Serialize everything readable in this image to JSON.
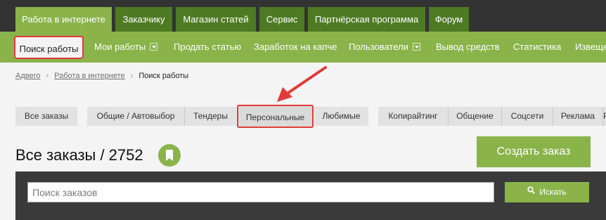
{
  "top_tabs": [
    {
      "label": "Работа в интернете"
    },
    {
      "label": "Заказчику"
    },
    {
      "label": "Магазин статей"
    },
    {
      "label": "Сервис"
    },
    {
      "label": "Партнёрская программа"
    },
    {
      "label": "Форум"
    }
  ],
  "subnav": [
    {
      "label": "Поиск работы"
    },
    {
      "label": "Мои работы"
    },
    {
      "label": "Продать статью"
    },
    {
      "label": "Заработок на капче"
    },
    {
      "label": "Пользователи"
    },
    {
      "label": "Вывод средств"
    },
    {
      "label": "Статистика"
    },
    {
      "label": "Извещен"
    }
  ],
  "breadcrumb": {
    "items": [
      "Адвего",
      "Работа в интернете"
    ],
    "current": "Поиск работы",
    "separator": "›"
  },
  "filters": [
    {
      "label": "Все заказы"
    },
    {
      "label": "Общие / Автовыбор"
    },
    {
      "label": "Тендеры"
    },
    {
      "label": "Персональные"
    },
    {
      "label": "Любимые"
    },
    {
      "label": "Копирайтинг"
    },
    {
      "label": "Общение"
    },
    {
      "label": "Соцсети"
    },
    {
      "label": "Реклама"
    },
    {
      "label": "Ре"
    }
  ],
  "page_title": "Все заказы / 2752",
  "create_button": "Создать заказ",
  "search": {
    "placeholder": "Поиск заказов",
    "value": "",
    "button": "Искать"
  },
  "colors": {
    "accent": "#8ab34a",
    "dark_tab": "#4e7a24",
    "highlight": "#e03a3a",
    "topbar": "#333333",
    "panel": "#3a3a3a"
  },
  "icons": {
    "bookmark": "bookmark-icon",
    "search": "search-icon",
    "dropdown": "chevron-down-icon"
  }
}
